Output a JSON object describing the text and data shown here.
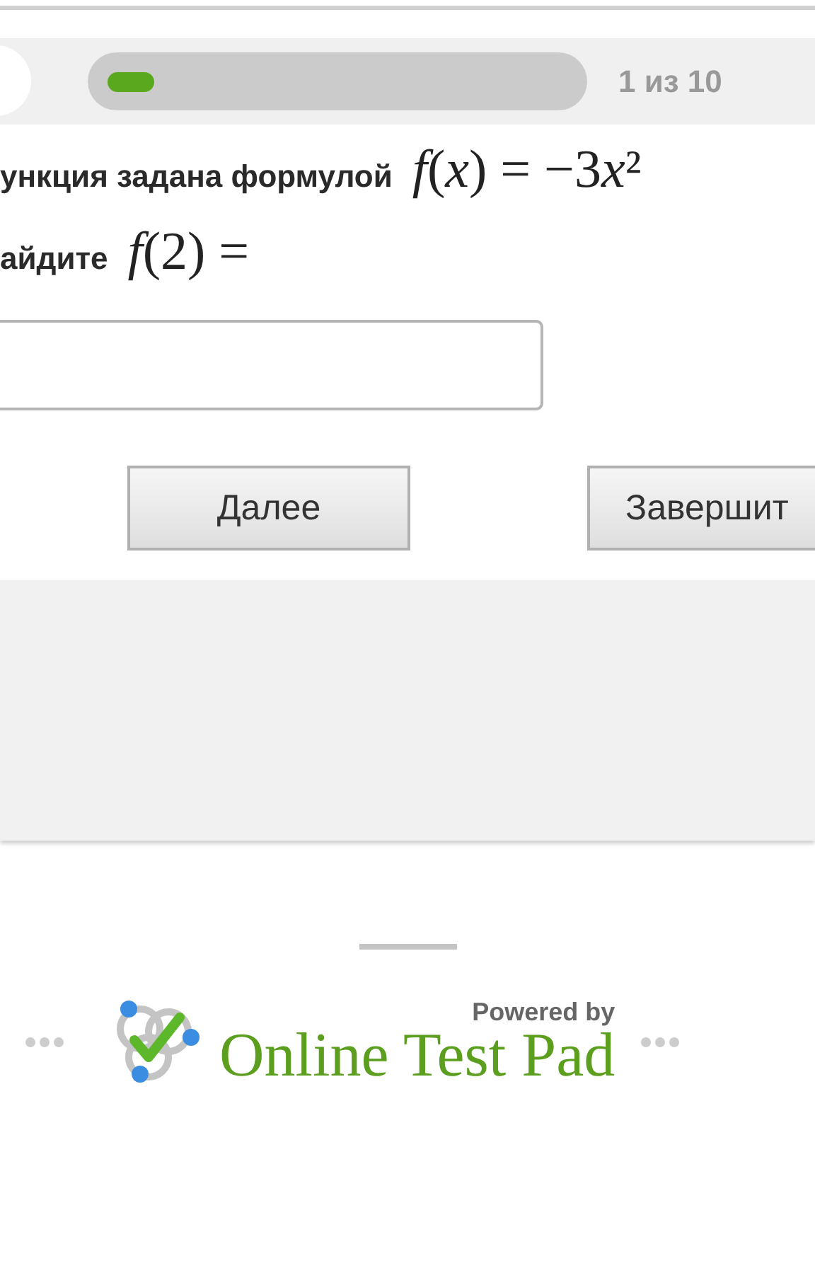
{
  "progress": {
    "level": 0.1,
    "counter": "1 из 10"
  },
  "question": {
    "lines": [
      {
        "text": "ункция задана формулой",
        "formula": [
          {
            "text": "f",
            "italic": true
          },
          {
            "text": "(",
            "italic": false
          },
          {
            "text": "x",
            "italic": true
          },
          {
            "text": ") = −3",
            "italic": false
          },
          {
            "text": "x",
            "italic": true
          },
          {
            "text": "²",
            "italic": false
          }
        ]
      },
      {
        "text": "айдите",
        "formula": [
          {
            "text": "f",
            "italic": true
          },
          {
            "text": "(2) =",
            "italic": false
          }
        ]
      }
    ]
  },
  "buttons": [
    {
      "label": "Далее"
    },
    {
      "label": "Завершит"
    }
  ],
  "footer": {
    "powered_by": "Powered by",
    "brand": "Online Test Pad"
  }
}
